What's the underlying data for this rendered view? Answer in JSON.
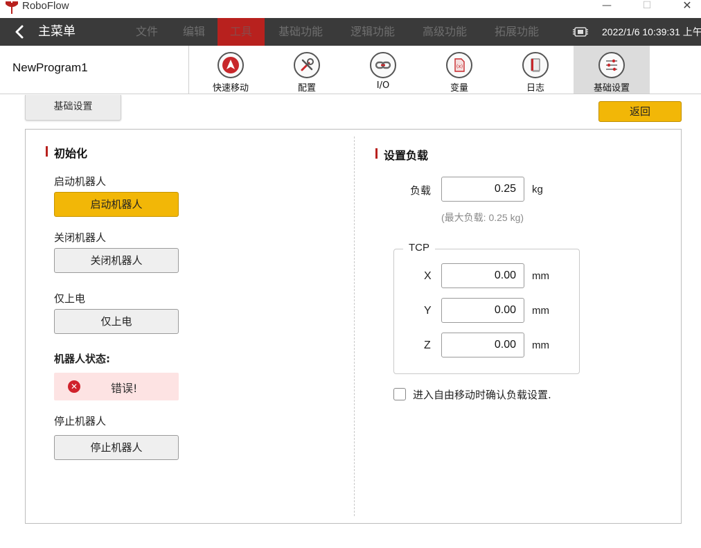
{
  "window": {
    "title": "RoboFlow",
    "minimize": "—",
    "maximize": "☐",
    "close": "✕"
  },
  "menubar": {
    "title": "主菜单",
    "items": [
      {
        "label": "文件",
        "active": false
      },
      {
        "label": "编辑",
        "active": false
      },
      {
        "label": "工具",
        "active": true
      },
      {
        "label": "基础功能",
        "active": false
      },
      {
        "label": "逻辑功能",
        "active": false
      },
      {
        "label": "高级功能",
        "active": false
      },
      {
        "label": "拓展功能",
        "active": false
      }
    ],
    "datetime": "2022/1/6 10:39:31 上午"
  },
  "toolbar": {
    "program_name": "NewProgram1",
    "tools": [
      {
        "label": "快速移动",
        "icon": "quick-move-icon",
        "active": false
      },
      {
        "label": "配置",
        "icon": "config-tools-icon",
        "active": false
      },
      {
        "label": "I/O",
        "icon": "io-link-icon",
        "active": false
      },
      {
        "label": "变量",
        "icon": "variable-icon",
        "active": false
      },
      {
        "label": "日志",
        "icon": "log-book-icon",
        "active": false
      },
      {
        "label": "基础设置",
        "icon": "sliders-icon",
        "active": true
      }
    ]
  },
  "tab": {
    "label": "基础设置"
  },
  "back_button": "返回",
  "init": {
    "title": "初始化",
    "start_label": "启动机器人",
    "start_button": "启动机器人",
    "stop_power_label": "关闭机器人",
    "stop_power_button": "关闭机器人",
    "power_only_label": "仅上电",
    "power_only_button": "仅上电",
    "status_label": "机器人状态:",
    "status_icon": "error-icon",
    "status_text": "错误!",
    "halt_label": "停止机器人",
    "halt_button": "停止机器人"
  },
  "payload": {
    "title": "设置负载",
    "load_label": "负载",
    "load_value": "0.25",
    "load_unit": "kg",
    "max_hint": "(最大负载: 0.25 kg)",
    "tcp_legend": "TCP",
    "tcp": [
      {
        "axis": "X",
        "value": "0.00",
        "unit": "mm"
      },
      {
        "axis": "Y",
        "value": "0.00",
        "unit": "mm"
      },
      {
        "axis": "Z",
        "value": "0.00",
        "unit": "mm"
      }
    ],
    "confirm_checkbox_checked": false,
    "confirm_label": "进入自由移动时确认负载设置."
  },
  "colors": {
    "menubar_bg": "#3a3a3a",
    "active_red": "#b8211e",
    "primary_yellow": "#f2b707",
    "error_bg": "#fde3e3",
    "error_icon": "#d0222c"
  }
}
